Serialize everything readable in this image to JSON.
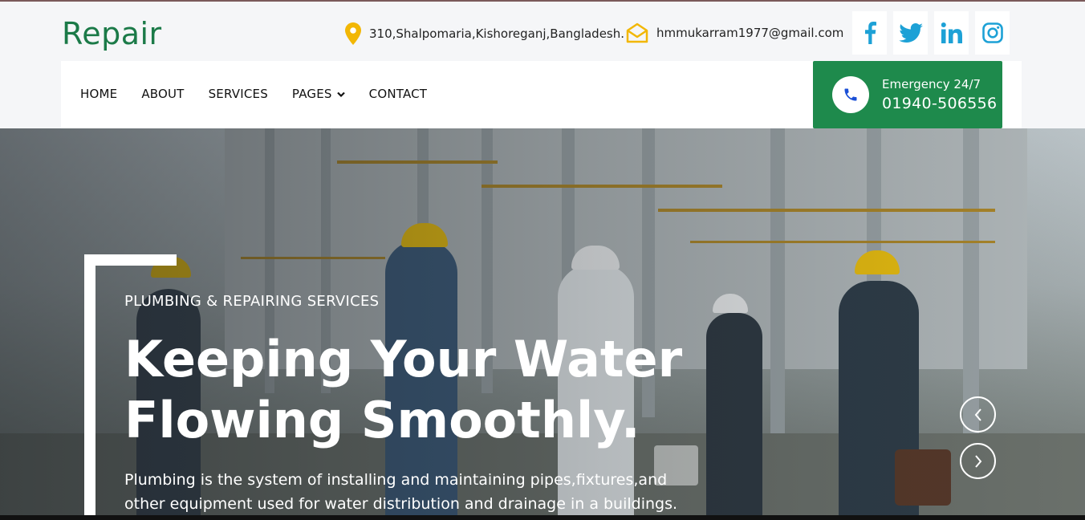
{
  "header": {
    "logo": "Repair",
    "address": "310,Shalpomaria,Kishoreganj,Bangladesh.",
    "email": "hmmukarram1977@gmail.com",
    "socials": [
      "facebook-icon",
      "twitter-icon",
      "linkedin-icon",
      "instagram-icon"
    ]
  },
  "nav": {
    "items": [
      "HOME",
      "ABOUT",
      "SERVICES",
      "PAGES",
      "CONTACT"
    ]
  },
  "emergency": {
    "label": "Emergency 24/7",
    "number": "01940-506556"
  },
  "hero": {
    "eyebrow": "PLUMBING & REPAIRING SERVICES",
    "title": "Keeping Your Water Flowing Smoothly.",
    "description": "Plumbing is the system of installing and maintaining pipes,fixtures,and other equipment used for water distribution and drainage in a buildings."
  },
  "colors": {
    "brand_green": "#1b7a48",
    "emergency_green": "#1e8a4c",
    "icon_yellow": "#f2b705",
    "social_blue": "#1da1d6"
  }
}
